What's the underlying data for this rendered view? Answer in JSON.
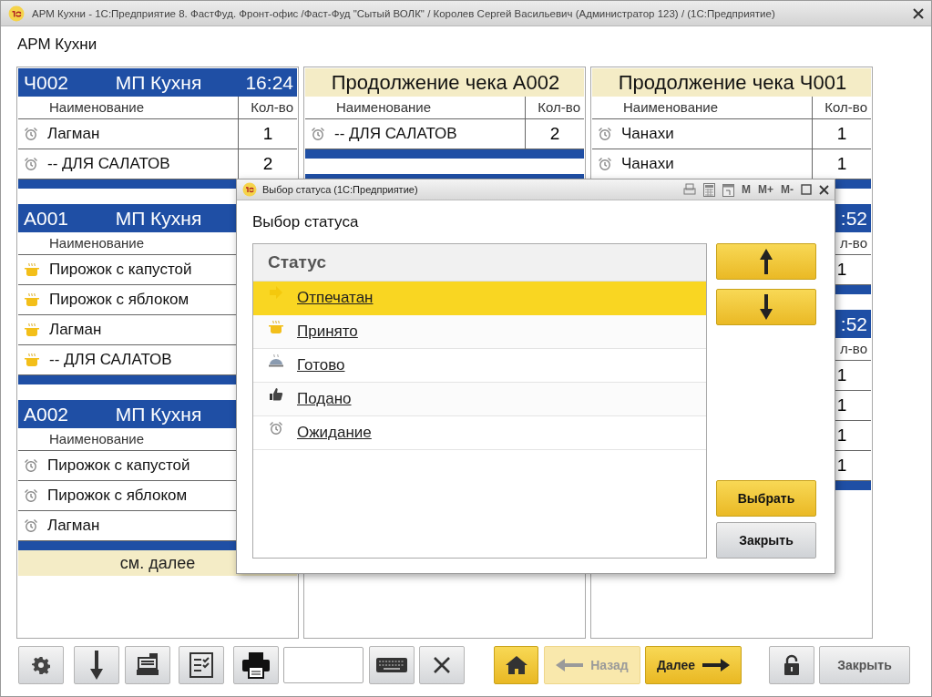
{
  "window": {
    "title": "АРМ Кухни - 1С:Предприятие 8. ФастФуд. Фронт-офис /Фаст-Фуд \"Сытый ВОЛК\" / Королев Сергей Васильевич (Администратор 123) /  (1С:Предприятие)"
  },
  "page_title": "АРМ Кухни",
  "board": {
    "columns": [
      {
        "cards": [
          {
            "header": {
              "kind": "order",
              "number": "Ч002",
              "kitchen": "МП Кухня",
              "time": "16:24"
            },
            "columns": {
              "name": "Наименование",
              "qty": "Кол-во"
            },
            "rows": [
              {
                "kind": "waiting",
                "name": "Лагман",
                "qty": "1"
              },
              {
                "kind": "waiting",
                "name": "-- ДЛЯ САЛАТОВ",
                "qty": "2"
              }
            ]
          },
          {
            "header": {
              "kind": "order",
              "number": "А001",
              "kitchen": "МП Кухня"
            },
            "columns": {
              "name": "Наименование"
            },
            "rows": [
              {
                "kind": "accepted",
                "name": "Пирожок с капустой"
              },
              {
                "kind": "accepted",
                "name": "Пирожок с яблоком"
              },
              {
                "kind": "accepted",
                "name": "Лагман"
              },
              {
                "kind": "accepted",
                "name": "-- ДЛЯ САЛАТОВ"
              }
            ]
          },
          {
            "header": {
              "kind": "order",
              "number": "А002",
              "kitchen": "МП Кухня"
            },
            "columns": {
              "name": "Наименование"
            },
            "rows": [
              {
                "kind": "waiting",
                "name": "Пирожок с капустой"
              },
              {
                "kind": "waiting",
                "name": "Пирожок с яблоком"
              },
              {
                "kind": "waiting",
                "name": "Лагман"
              }
            ],
            "footer": "см. далее"
          }
        ]
      },
      {
        "cards": [
          {
            "header": {
              "kind": "continuation",
              "title": "Продолжение чека А002"
            },
            "columns": {
              "name": "Наименование",
              "qty": "Кол-во"
            },
            "rows": [
              {
                "kind": "waiting",
                "name": "-- ДЛЯ САЛАТОВ",
                "qty": "2"
              }
            ]
          },
          {
            "header": {
              "kind": "order"
            }
          }
        ]
      },
      {
        "cards": [
          {
            "header": {
              "kind": "continuation",
              "title": "Продолжение чека Ч001"
            },
            "columns": {
              "name": "Наименование",
              "qty": "Кол-во"
            },
            "rows": [
              {
                "kind": "waiting",
                "name": "Чанахи",
                "qty": "1"
              },
              {
                "kind": "waiting",
                "name": "Чанахи",
                "qty": "1"
              }
            ]
          },
          {
            "header": {
              "kind": "order",
              "time": ":52"
            },
            "columns": {
              "qty": "л-во"
            },
            "rows": [
              {
                "qty": "1"
              }
            ]
          },
          {
            "header": {
              "kind": "order",
              "time": ":52"
            },
            "columns": {
              "qty": "л-во"
            },
            "rows": [
              {
                "qty": "1"
              },
              {
                "qty": "1"
              },
              {
                "qty": "1"
              },
              {
                "qty": "1"
              }
            ]
          }
        ]
      }
    ]
  },
  "dialog": {
    "title": "Выбор статуса  (1С:Предприятие)",
    "memory_buttons": [
      "M",
      "M+",
      "M-"
    ],
    "heading": "Выбор статуса",
    "list_header": "Статус",
    "items": [
      {
        "kind": "printed",
        "label": "Отпечатан",
        "selected": true
      },
      {
        "kind": "accepted",
        "label": "Принято",
        "selected": false
      },
      {
        "kind": "ready",
        "label": "Готово",
        "selected": false
      },
      {
        "kind": "served",
        "label": "Подано",
        "selected": false
      },
      {
        "kind": "waiting",
        "label": "Ожидание",
        "selected": false
      }
    ],
    "choose_button": "Выбрать",
    "close_button": "Закрыть"
  },
  "toolbar": {
    "back": {
      "label": "Назад",
      "disabled": true
    },
    "next": {
      "label": "Далее",
      "disabled": false
    },
    "close": {
      "label": "Закрыть"
    }
  }
}
